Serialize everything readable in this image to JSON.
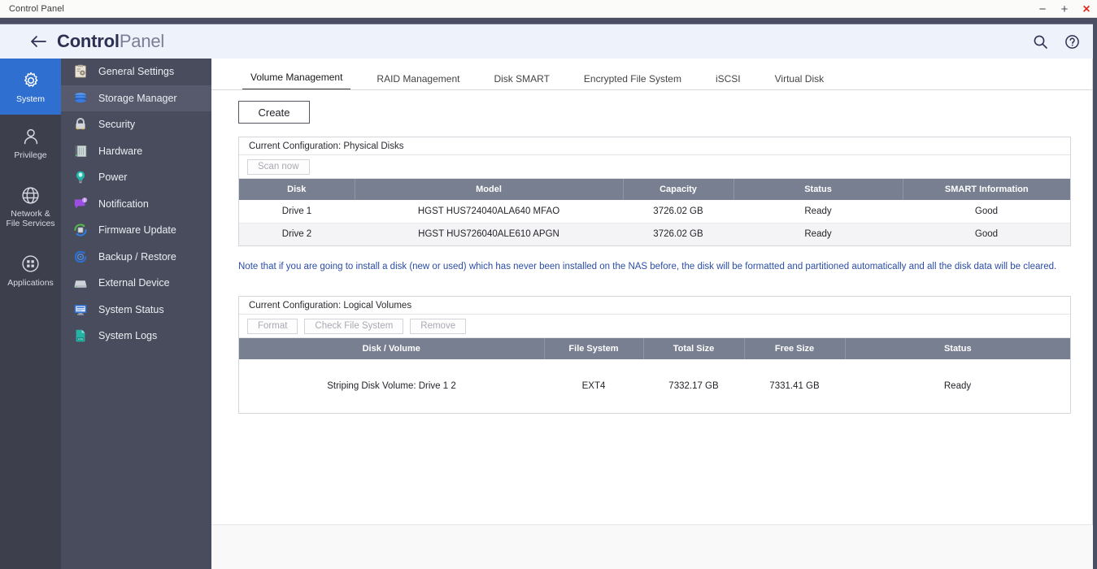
{
  "window": {
    "title": "Control Panel",
    "minimize_label": "−",
    "maximize_label": "+",
    "close_label": "×"
  },
  "header": {
    "back_label": "←",
    "brand_bold": "Control",
    "brand_light": "Panel",
    "search_icon": "search-icon",
    "help_icon": "help-icon"
  },
  "rail": {
    "items": [
      {
        "label": "System",
        "icon": "gear-icon",
        "active": true
      },
      {
        "label": "Privilege",
        "icon": "user-icon",
        "active": false
      },
      {
        "label": "Network &\nFile Services",
        "icon": "globe-icon",
        "active": false
      },
      {
        "label": "Applications",
        "icon": "grid-icon",
        "active": false
      }
    ]
  },
  "sidebar": {
    "items": [
      {
        "label": "General Settings",
        "icon": "clipboard-gear-icon",
        "active": false
      },
      {
        "label": "Storage Manager",
        "icon": "database-icon",
        "active": true
      },
      {
        "label": "Security",
        "icon": "padlock-icon",
        "active": false
      },
      {
        "label": "Hardware",
        "icon": "cabinet-icon",
        "active": false
      },
      {
        "label": "Power",
        "icon": "bulb-icon",
        "active": false
      },
      {
        "label": "Notification",
        "icon": "speech-bubble-icon",
        "active": false
      },
      {
        "label": "Firmware Update",
        "icon": "refresh-chip-icon",
        "active": false
      },
      {
        "label": "Backup / Restore",
        "icon": "backup-gear-icon",
        "active": false
      },
      {
        "label": "External Device",
        "icon": "external-drive-icon",
        "active": false
      },
      {
        "label": "System Status",
        "icon": "monitor-icon",
        "active": false
      },
      {
        "label": "System Logs",
        "icon": "log-document-icon",
        "active": false
      }
    ]
  },
  "tabs": [
    {
      "label": "Volume Management",
      "active": true
    },
    {
      "label": "RAID Management",
      "active": false
    },
    {
      "label": "Disk SMART",
      "active": false
    },
    {
      "label": "Encrypted File System",
      "active": false
    },
    {
      "label": "iSCSI",
      "active": false
    },
    {
      "label": "Virtual Disk",
      "active": false
    }
  ],
  "main": {
    "create_button": "Create",
    "physical": {
      "panel_title": "Current Configuration: Physical Disks",
      "scan_button": "Scan now",
      "columns": [
        "Disk",
        "Model",
        "Capacity",
        "Status",
        "SMART Information"
      ],
      "rows": [
        {
          "disk": "Drive 1",
          "model": "HGST HUS724040ALA640 MFAO",
          "capacity": "3726.02 GB",
          "status": "Ready",
          "smart": "Good"
        },
        {
          "disk": "Drive 2",
          "model": "HGST HUS726040ALE610 APGN",
          "capacity": "3726.02 GB",
          "status": "Ready",
          "smart": "Good"
        }
      ]
    },
    "note": "Note that if you are going to install a disk (new or used) which has never been installed on the NAS before, the disk will be formatted and partitioned automatically and all the disk data will be cleared.",
    "logical": {
      "panel_title": "Current Configuration: Logical Volumes",
      "buttons": [
        "Format",
        "Check File System",
        "Remove"
      ],
      "columns": [
        "Disk / Volume",
        "File System",
        "Total Size",
        "Free Size",
        "Status"
      ],
      "rows": [
        {
          "volume": "Striping Disk Volume: Drive 1 2",
          "filesystem": "EXT4",
          "total": "7332.17 GB",
          "free": "7331.41 GB",
          "status": "Ready"
        }
      ]
    }
  },
  "colors": {
    "rail_bg": "#3d3f4d",
    "menu_bg": "#494c5c",
    "accent_blue": "#2f6fd0",
    "header_bg": "#eef2fb",
    "table_header": "#777f91",
    "note_blue": "#2c4da8",
    "good_green": "#16a016",
    "close_red": "#e02b20"
  }
}
